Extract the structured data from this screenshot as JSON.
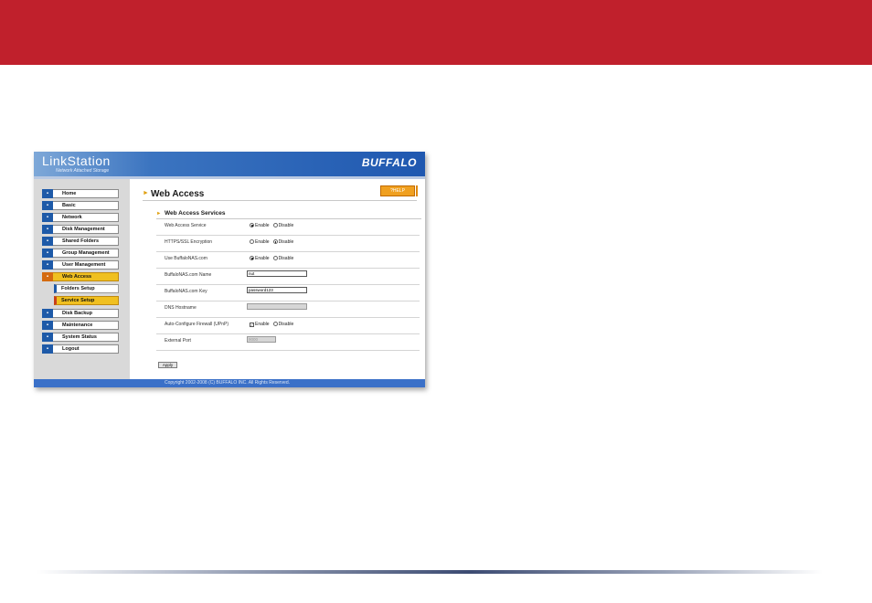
{
  "header": {
    "brand": "LinkStation",
    "tagline": "Network Attached Storage",
    "logo": "BUFFALO",
    "colors": {
      "banner": "#c0202c",
      "header_blue": "#1f58b0",
      "active_item": "#f0c020"
    }
  },
  "sidebar": {
    "items": [
      {
        "label": "Home",
        "icon": "home-icon"
      },
      {
        "label": "Basic",
        "icon": "basic-icon"
      },
      {
        "label": "Network",
        "icon": "network-icon"
      },
      {
        "label": "Disk Management",
        "icon": "disk-icon"
      },
      {
        "label": "Shared Folders",
        "icon": "folder-icon"
      },
      {
        "label": "Group Management",
        "icon": "group-icon"
      },
      {
        "label": "User Management",
        "icon": "user-icon"
      },
      {
        "label": "Web Access",
        "icon": "web-icon",
        "active": true
      },
      {
        "label": "Disk Backup",
        "icon": "backup-icon"
      },
      {
        "label": "Maintenance",
        "icon": "maintenance-icon"
      },
      {
        "label": "System Status",
        "icon": "status-icon"
      },
      {
        "label": "Logout",
        "icon": "logout-icon"
      }
    ],
    "subitems": [
      {
        "label": "Folders Setup"
      },
      {
        "label": "Service Setup",
        "active": true
      }
    ]
  },
  "main": {
    "title": "Web Access",
    "help_label": "?HELP",
    "section_title": "Web Access Services",
    "enable_label": "Enable",
    "disable_label": "Disable",
    "rows": {
      "service": {
        "label": "Web Access Service",
        "selected": "Enable"
      },
      "ssl": {
        "label": "HTTPS/SSL Encryption",
        "selected": "Disable"
      },
      "buffalonas": {
        "label": "Use BuffaloNAS.com",
        "selected": "Enable"
      },
      "name": {
        "label": "BuffaloNAS.com Name",
        "value": "nut"
      },
      "key": {
        "label": "BuffaloNAS.com Key",
        "value": "password123"
      },
      "dns": {
        "label": "DNS Hostname",
        "value": ""
      },
      "upnp": {
        "label": "Auto-Configure Firewall (UPnP)",
        "checked": true
      },
      "port": {
        "label": "External Port",
        "value": "9000"
      }
    },
    "apply_label": "Apply"
  },
  "footer": {
    "copyright": "Copyright 2002-2008 (C) BUFFALO INC. All Rights Reserved."
  }
}
